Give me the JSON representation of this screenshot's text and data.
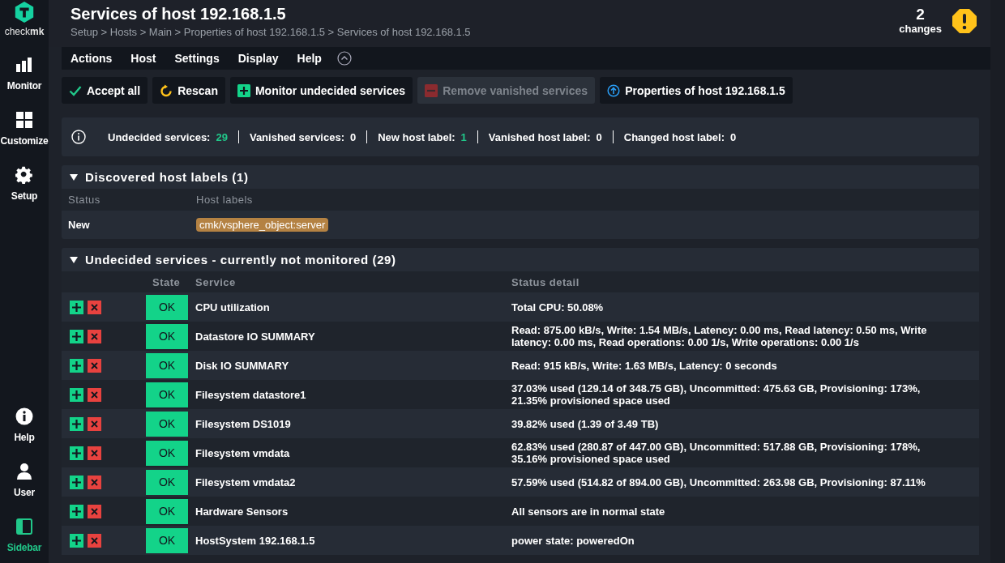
{
  "sidebar": {
    "logo": "check**mk**",
    "items": [
      {
        "kind": "monitor",
        "label": "Monitor",
        "selected": false
      },
      {
        "kind": "customize",
        "label": "Customize",
        "selected": false
      },
      {
        "kind": "setup",
        "label": "Setup",
        "selected": false
      },
      {
        "kind": "help",
        "label": "Help",
        "selected": false
      },
      {
        "kind": "user",
        "label": "User",
        "selected": false
      },
      {
        "kind": "sidebar",
        "label": "Sidebar",
        "selected": true
      }
    ]
  },
  "header": {
    "title": "Services of host 192.168.1.5",
    "breadcrumb": "Setup > Hosts > Main > Properties of host 192.168.1.5 > Services of host 192.168.1.5",
    "changes_count": "2",
    "changes_label": "changes"
  },
  "menu": [
    "Actions",
    "Host",
    "Settings",
    "Display",
    "Help"
  ],
  "toolbar": [
    {
      "kind": "accept",
      "label": "Accept all",
      "disabled": false
    },
    {
      "kind": "rescan",
      "label": "Rescan",
      "disabled": false
    },
    {
      "kind": "monitor",
      "label": "Monitor undecided services",
      "disabled": false
    },
    {
      "kind": "remove",
      "label": "Remove vanished services",
      "disabled": true
    },
    {
      "kind": "properties",
      "label": "Properties of host 192.168.1.5",
      "disabled": false
    }
  ],
  "summary": [
    {
      "label": "Undecided services:",
      "value": "29",
      "color": "#21c88a"
    },
    {
      "label": "Vanished services:",
      "value": "0",
      "color": "#ffffff"
    },
    {
      "label": "New host label:",
      "value": "1",
      "color": "#21c88a"
    },
    {
      "label": "Vanished host label:",
      "value": "0",
      "color": "#ffffff"
    },
    {
      "label": "Changed host label:",
      "value": "0",
      "color": "#ffffff"
    }
  ],
  "host_labels": {
    "title": "Discovered host labels (1)",
    "expanded": true,
    "columns": [
      "Status",
      "Host labels"
    ],
    "rows": [
      {
        "status": "New",
        "label": "cmk/vsphere_object:server"
      }
    ]
  },
  "undecided": {
    "title": "Undecided services - currently not monitored (29)",
    "expanded": true,
    "columns": [
      "State",
      "Service",
      "Status detail"
    ],
    "rows": [
      {
        "state": "OK",
        "color": "#13d389",
        "service": "CPU utilization",
        "detail": "Total CPU: 50.08%"
      },
      {
        "state": "OK",
        "color": "#13d389",
        "service": "Datastore IO SUMMARY",
        "detail": "Read: 875.00 kB/s, Write: 1.54 MB/s, Latency: 0.00 ms, Read latency: 0.50 ms, Write latency: 0.00 ms, Read operations: 0.00 1/s, Write operations: 0.00 1/s"
      },
      {
        "state": "OK",
        "color": "#13d389",
        "service": "Disk IO SUMMARY",
        "detail": "Read: 915 kB/s, Write: 1.63 MB/s, Latency: 0 seconds"
      },
      {
        "state": "OK",
        "color": "#13d389",
        "service": "Filesystem datastore1",
        "detail": "37.03% used (129.14 of 348.75 GB), Uncommitted: 475.63 GB, Provisioning: 173%, 21.35% provisioned space used"
      },
      {
        "state": "OK",
        "color": "#13d389",
        "service": "Filesystem DS1019",
        "detail": "39.82% used (1.39 of 3.49 TB)"
      },
      {
        "state": "OK",
        "color": "#13d389",
        "service": "Filesystem vmdata",
        "detail": "62.83% used (280.87 of 447.00 GB), Uncommitted: 517.88 GB, Provisioning: 178%, 35.16% provisioned space used"
      },
      {
        "state": "OK",
        "color": "#13d389",
        "service": "Filesystem vmdata2",
        "detail": "57.59% used (514.82 of 894.00 GB), Uncommitted: 263.98 GB, Provisioning: 87.11%"
      },
      {
        "state": "OK",
        "color": "#13d389",
        "service": "Hardware Sensors",
        "detail": "All sensors are in normal state"
      },
      {
        "state": "OK",
        "color": "#13d389",
        "service": "HostSystem 192.168.1.5",
        "detail": "power state: poweredOn"
      }
    ]
  }
}
